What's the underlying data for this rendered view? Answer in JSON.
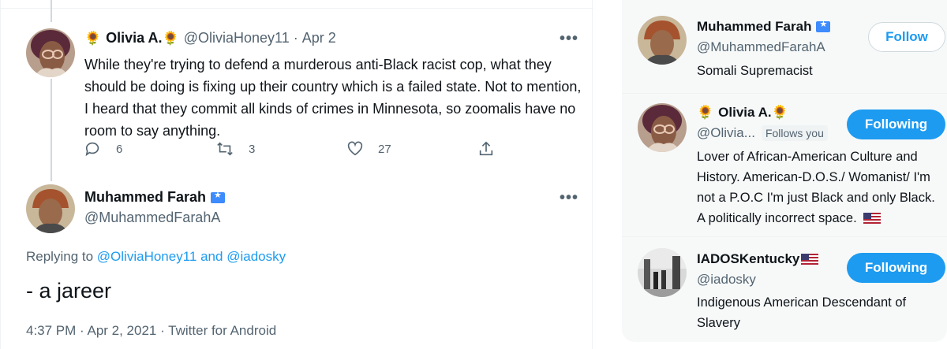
{
  "tweet1": {
    "display_name": "Olivia A.",
    "sunflower_emoji": "🌻",
    "handle": "@OliviaHoney11",
    "separator": "·",
    "date": "Apr 2",
    "text": "While they're trying to defend a murderous anti-Black racist cop, what they should be doing is fixing up their country which is a failed state. Not to mention, I heard that they commit all kinds of crimes in Minnesota, so zoomalis have no room to say anything.",
    "reply_count": "6",
    "retweet_count": "3",
    "like_count": "27",
    "more_label": "•••"
  },
  "tweet2": {
    "display_name": "Muhammed Farah",
    "handle": "@MuhammedFarahA",
    "more_label": "•••",
    "replying_prefix": "Replying to",
    "replying_user1": "@OliviaHoney11",
    "replying_and": "and",
    "replying_user2": "@iadosky",
    "text": "- a jareer",
    "meta": "4:37 PM · Apr 2, 2021 · Twitter for Android"
  },
  "sidebar": {
    "users": [
      {
        "display_name": "Muhammed Farah",
        "handle": "@MuhammedFarahA",
        "bio": "Somali Supremacist",
        "button": "Follow"
      },
      {
        "display_name": "Olivia A.",
        "handle": "@Olivia...",
        "follows_you": "Follows you",
        "bio": "Lover of African-American Culture and History. American-D.O.S./ Womanist/ I'm not a P.O.C I'm just Black and only Black. A politically incorrect space.",
        "button": "Following"
      },
      {
        "display_name": "IADOSKentucky",
        "handle": "@iadosky",
        "bio": "Indigenous American Descendant of Slavery",
        "button": "Following"
      }
    ]
  },
  "colors": {
    "accent": "#1d9bf0",
    "secondary_text": "#536471",
    "verified": "#3d8bfd"
  }
}
